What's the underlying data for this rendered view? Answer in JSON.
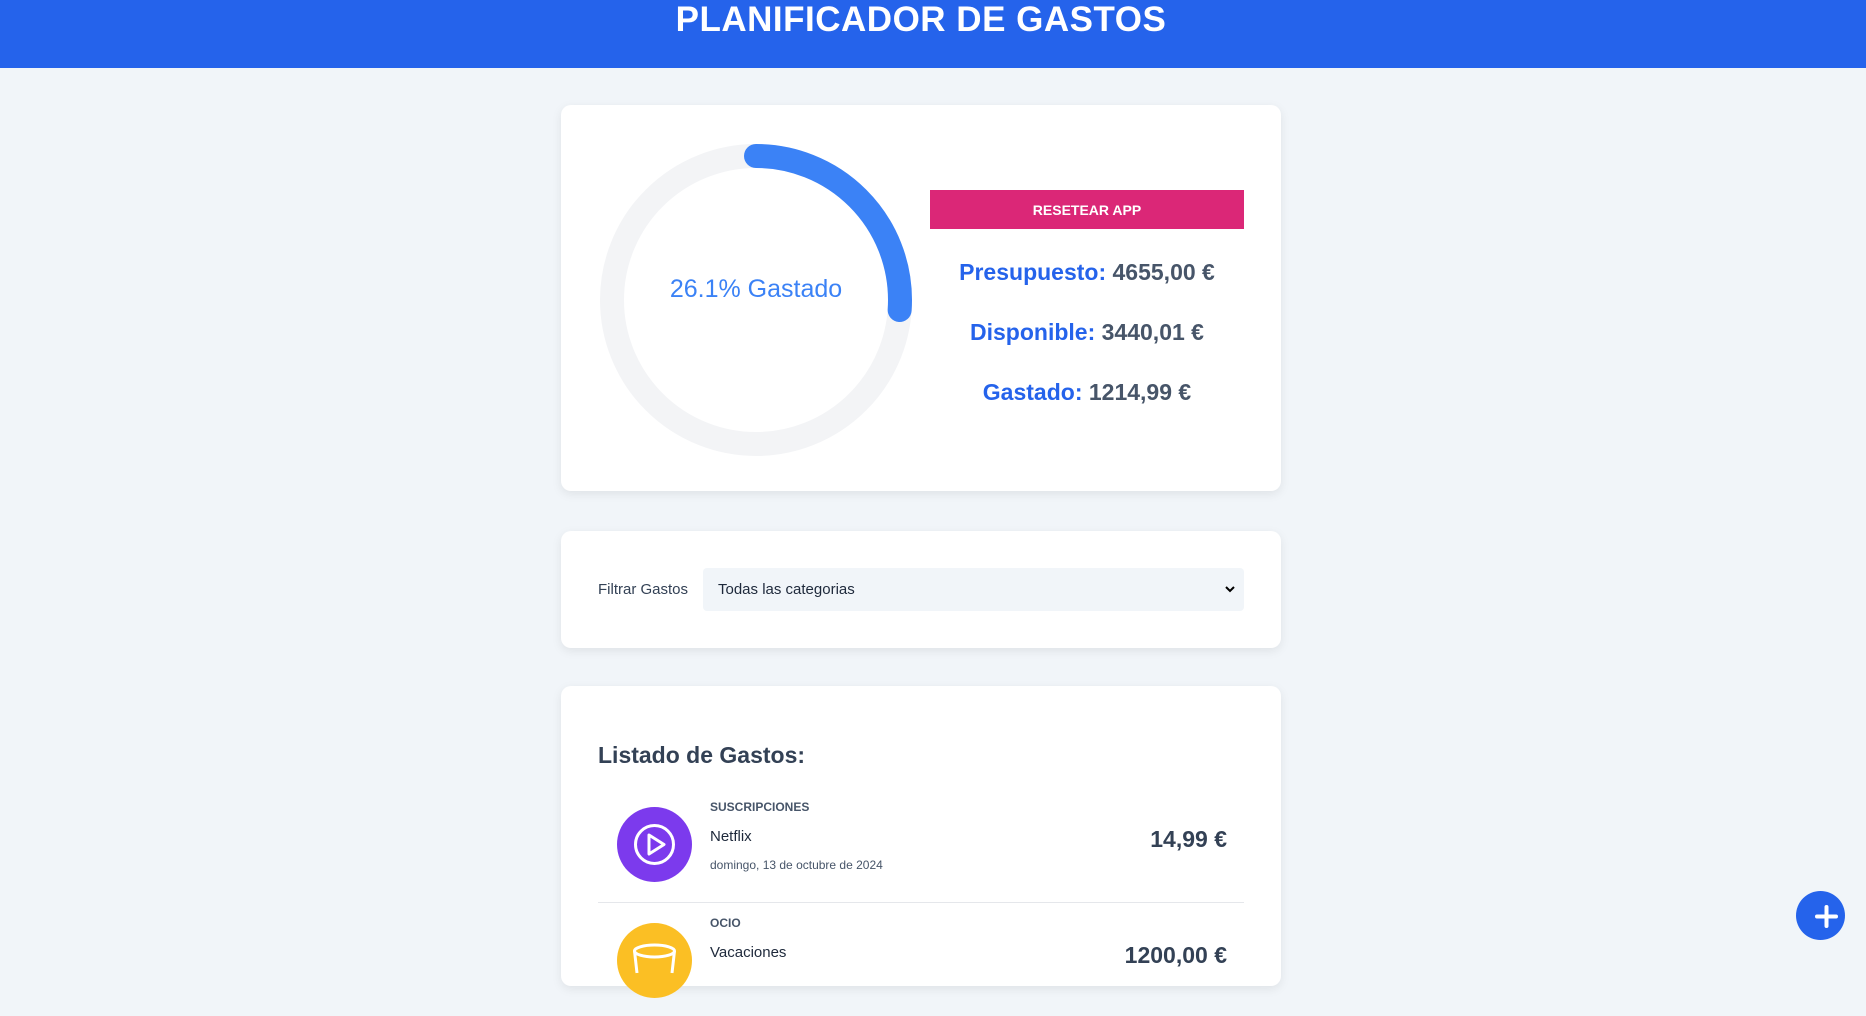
{
  "header": {
    "title": "PLANIFICADOR DE GASTOS"
  },
  "budget": {
    "spent_percent": 26.1,
    "spent_label": "26.1% Gastado",
    "reset_label": "RESETEAR APP",
    "presupuesto_label": "Presupuesto:",
    "presupuesto_value": "4655,00 €",
    "disponible_label": "Disponible:",
    "disponible_value": "3440,01 €",
    "gastado_label": "Gastado:",
    "gastado_value": "1214,99 €"
  },
  "filter": {
    "label": "Filtrar Gastos",
    "selected": "Todas las categorias"
  },
  "expenses": {
    "title": "Listado de Gastos:",
    "items": [
      {
        "category": "SUSCRIPCIONES",
        "name": "Netflix",
        "date": "domingo, 13 de octubre de 2024",
        "amount": "14,99 €",
        "icon": "play-icon",
        "color": "#7c3aed"
      },
      {
        "category": "OCIO",
        "name": "Vacaciones",
        "date": "",
        "amount": "1200,00 €",
        "icon": "leisure-icon",
        "color": "#fbbf24"
      }
    ]
  },
  "colors": {
    "primary": "#2563eb",
    "accent": "#db2777",
    "background": "#f1f5f9",
    "track": "#f3f4f6",
    "progress": "#3b82f6"
  }
}
